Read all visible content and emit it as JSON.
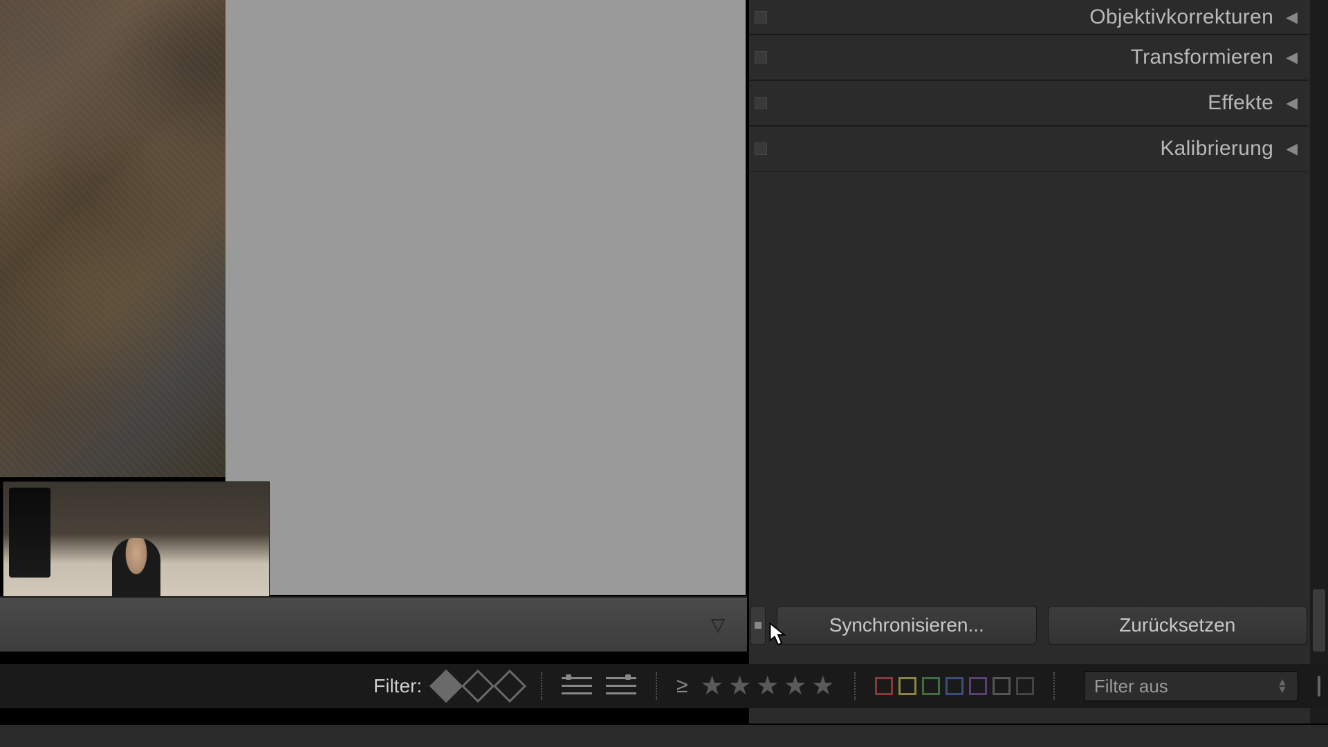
{
  "panels": [
    {
      "label": "Objektivkorrekturen"
    },
    {
      "label": "Transformieren"
    },
    {
      "label": "Effekte"
    },
    {
      "label": "Kalibrierung"
    }
  ],
  "buttons": {
    "sync": "Synchronisieren...",
    "reset": "Zurücksetzen"
  },
  "filter": {
    "label": "Filter:",
    "dropdown": "Filter aus",
    "stars_count": 5,
    "comparison": "≥"
  }
}
